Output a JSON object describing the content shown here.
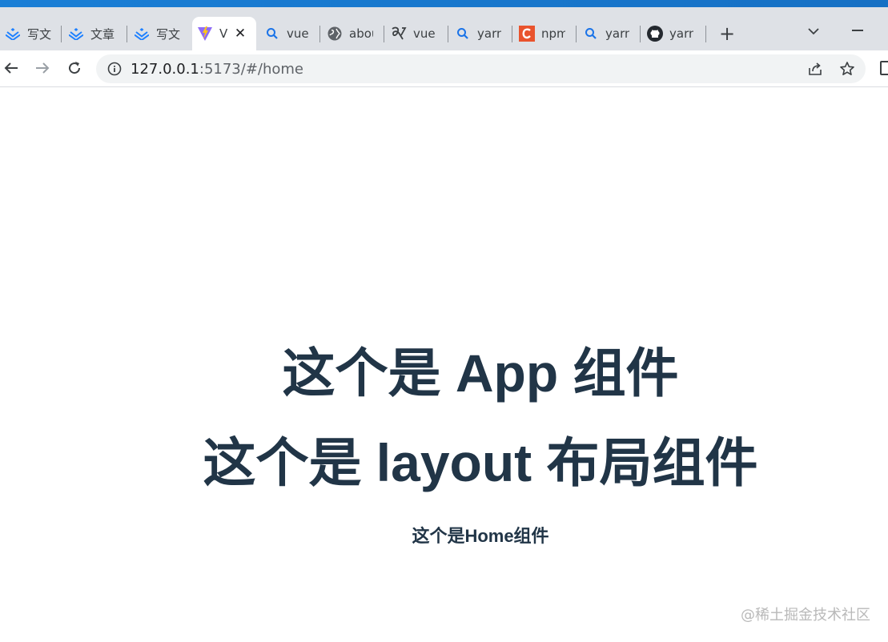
{
  "tabs": [
    {
      "title": "写文章",
      "icon": "juejin-icon"
    },
    {
      "title": "文章",
      "icon": "juejin-icon"
    },
    {
      "title": "写文章",
      "icon": "juejin-icon"
    },
    {
      "title": "Vite",
      "icon": "vite-icon",
      "active": true
    },
    {
      "title": "vue",
      "icon": "search-icon"
    },
    {
      "title": "about",
      "icon": "globe-icon"
    },
    {
      "title": "vue",
      "icon": "vue-icon"
    },
    {
      "title": "yarn",
      "icon": "search-icon"
    },
    {
      "title": "npm",
      "icon": "c-icon"
    },
    {
      "title": "yarn",
      "icon": "search-icon"
    },
    {
      "title": "yarn",
      "icon": "github-icon"
    }
  ],
  "new_tab_label": "+",
  "close_label": "✕",
  "address_bar": {
    "host": "127.0.0.1",
    "rest": ":5173/#/home"
  },
  "page": {
    "app_heading": "这个是 App 组件",
    "layout_heading": "这个是 layout 布局组件",
    "home_heading": "这个是Home组件",
    "watermark": "@稀土掘金技术社区"
  },
  "colors": {
    "heading": "#213547",
    "tabstrip": "#dee1e6",
    "accent": "#1a7fd6"
  }
}
